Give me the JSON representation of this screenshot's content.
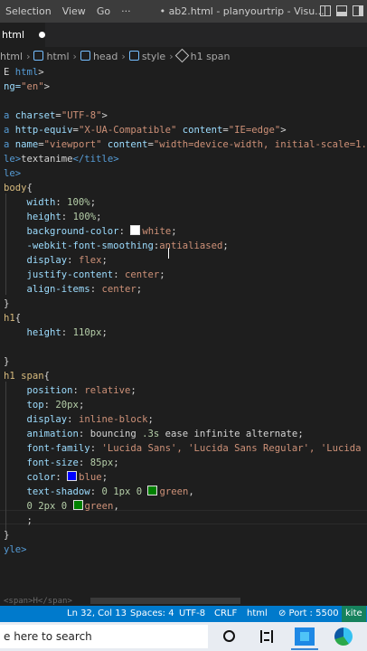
{
  "menubar": {
    "items": [
      "Selection",
      "View",
      "Go",
      "···"
    ],
    "title": "• ab2.html - planyourtrip - Visu..."
  },
  "tab": {
    "label": "html"
  },
  "breadcrumb": {
    "items": [
      "html",
      "html",
      "head",
      "style",
      "h1 span"
    ]
  },
  "code": {
    "l1a": "E ",
    "l1b": "html",
    "l1c": ">",
    "l2a": "ng=",
    "l2b": "\"en\"",
    "l2c": ">",
    "l3a": "a ",
    "l3b": "charset",
    "l3c": "=",
    "l3d": "\"UTF-8\"",
    "l3e": ">",
    "l4a": "a ",
    "l4b": "http-equiv",
    "l4c": "=",
    "l4d": "\"X-UA-Compatible\"",
    "l4e": " content",
    "l4f": "=",
    "l4g": "\"IE=edge\"",
    "l4h": ">",
    "l5a": "a ",
    "l5b": "name",
    "l5c": "=",
    "l5d": "\"viewport\"",
    "l5e": " content",
    "l5f": "=",
    "l5g": "\"width=device-width, initial-scale=1.",
    "l6a": "le>",
    "l6b": "textanime",
    "l6c": "</title>",
    "l7a": "le>",
    "l8a": "body",
    "l8b": "{",
    "l9a": "width",
    "l9b": ": ",
    "l9c": "100%",
    "l9d": ";",
    "l10a": "height",
    "l10b": ": ",
    "l10c": "100%",
    "l10d": ";",
    "l11a": "background-color",
    "l11b": ": ",
    "l11c": "white",
    "l11d": ";",
    "l12a": "-webkit-font-smoothing",
    "l12b": ":",
    "l12c": "antialiased",
    "l12d": ";",
    "l13a": "display",
    "l13b": ": ",
    "l13c": "flex",
    "l13d": ";",
    "l14a": "justify-content",
    "l14b": ": ",
    "l14c": "center",
    "l14d": ";",
    "l15a": "align-items",
    "l15b": ": ",
    "l15c": "center",
    "l15d": ";",
    "l16a": "}",
    "l17a": "h1",
    "l17b": "{",
    "l18a": "height",
    "l18b": ": ",
    "l18c": "110px",
    "l18d": ";",
    "l19a": "}",
    "l20a": "h1 span",
    "l20b": "{",
    "l21a": "position",
    "l21b": ": ",
    "l21c": "relative",
    "l21d": ";",
    "l22a": "top",
    "l22b": ": ",
    "l22c": "20px",
    "l22d": ";",
    "l23a": "display",
    "l23b": ": ",
    "l23c": "inline-block",
    "l23d": ";",
    "l24a": "animation",
    "l24b": ": ",
    "l24c": "bouncing ",
    "l24d": ".3s",
    "l24e": " ease infinite alternate",
    "l24f": ";",
    "l25a": "font-family",
    "l25b": ": ",
    "l25c": "'Lucida Sans', 'Lucida Sans Regular', 'Lucida",
    "l26a": "font-size",
    "l26b": ": ",
    "l26c": "85px",
    "l26d": ";",
    "l27a": "color",
    "l27b": ": ",
    "l27c": "blue",
    "l27d": ";",
    "l28a": "text-shadow",
    "l28b": ": ",
    "l28c": "0 1px 0 ",
    "l28d": "green",
    "l28e": ",",
    "l29a": "0 2px 0 ",
    "l29b": "green",
    "l29c": ",",
    "l30a": ";",
    "l31a": "}",
    "l32a": "yle>"
  },
  "peek": {
    "text": "<span>H</span>"
  },
  "status": {
    "position": "Ln 32, Col 13",
    "spaces": "Spaces: 4",
    "encoding": "UTF-8",
    "eol": "CRLF",
    "language": "html",
    "port": "⊘ Port : 5500",
    "live": "kite"
  },
  "taskbar": {
    "search_placeholder": "e here to search"
  },
  "colors": {
    "white_swatch": "#ffffff",
    "blue_swatch": "#0000ff",
    "green_swatch": "#008000",
    "status_bar": "#007acc"
  }
}
